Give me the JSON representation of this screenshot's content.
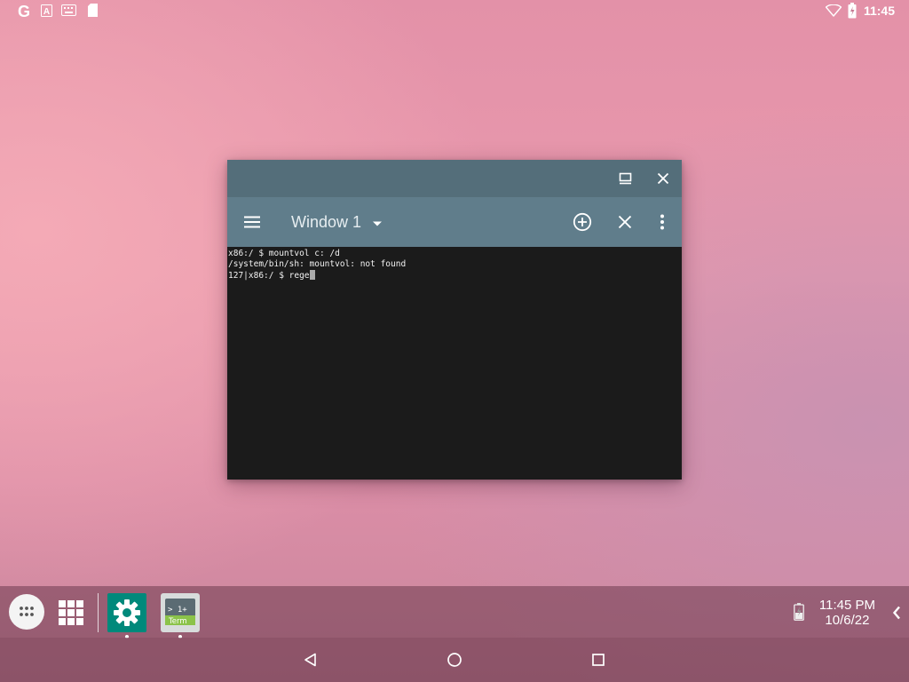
{
  "status_bar": {
    "left_icons": [
      "google-icon",
      "a-icon",
      "keyboard-icon",
      "sd-card-icon"
    ],
    "google_letter": "G",
    "a_letter": "A",
    "time": "11:45",
    "right_icons": [
      "wifi-icon",
      "battery-charging-icon"
    ]
  },
  "window": {
    "title_buttons": [
      "maximize-icon",
      "close-icon"
    ],
    "toolbar": {
      "menu_icon": "hamburger-menu-icon",
      "window_name": "Window 1",
      "dropdown_icon": "dropdown-arrow-icon",
      "actions": [
        "new-window-icon",
        "close-window-icon",
        "more-options-icon"
      ]
    },
    "terminal_lines": [
      "x86:/ $ mountvol c: /d",
      "/system/bin/sh: mountvol: not found"
    ],
    "prompt_line": "127|x86:/ $ rege"
  },
  "taskbar": {
    "apps": [
      {
        "name": "Settings",
        "icon": "gear-icon",
        "color": "#00897b"
      },
      {
        "name": "Terminal Emulator",
        "icon": "terminal-icon",
        "icon_text_top": "> 1+",
        "icon_text_bottom": "Term"
      }
    ],
    "tray_time": "11:45 PM",
    "tray_date": "10/6/22"
  },
  "nav_bar": {
    "buttons": [
      "back-icon",
      "home-icon",
      "recents-icon"
    ]
  },
  "colors": {
    "title_bar": "#546e7a",
    "toolbar": "#607d8b",
    "terminal_bg": "#1b1b1b"
  }
}
